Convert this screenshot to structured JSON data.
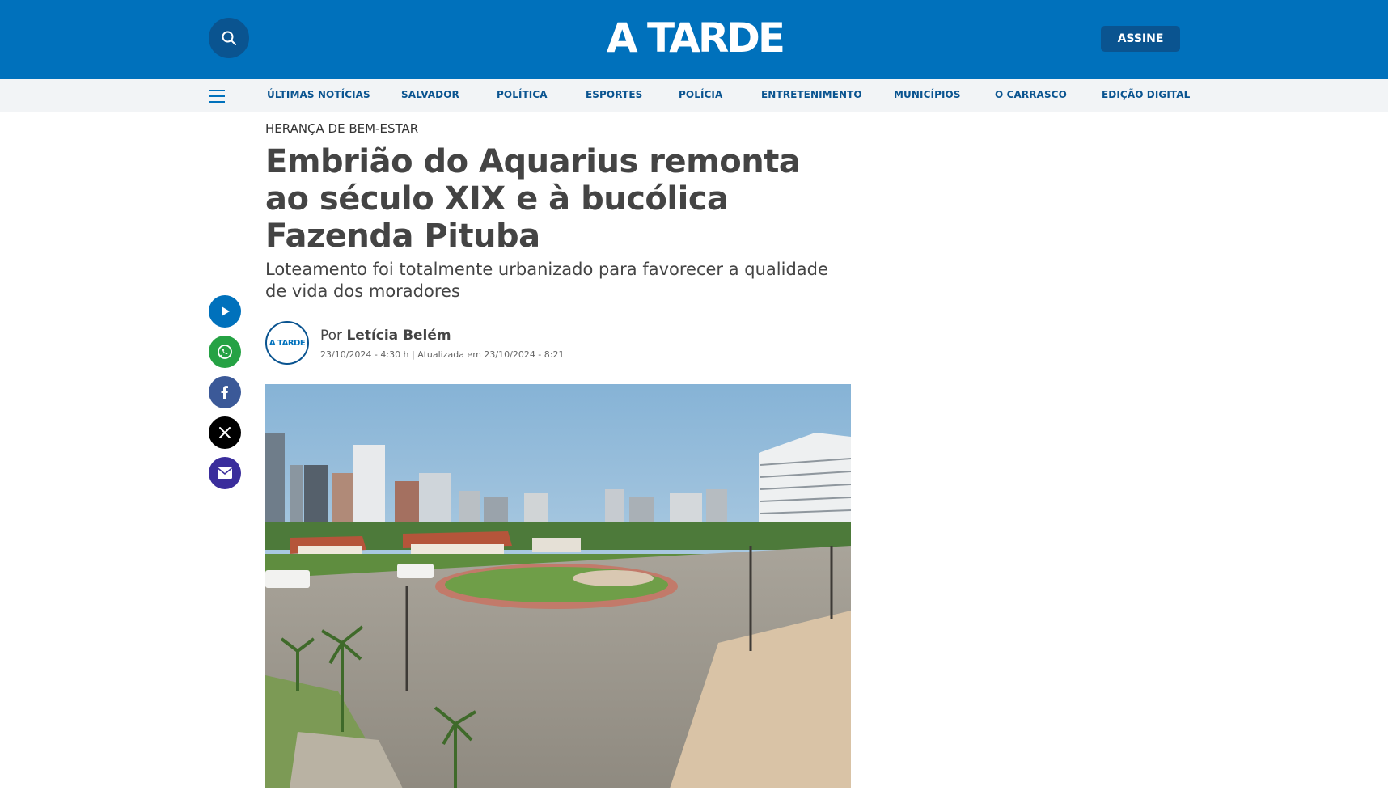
{
  "header": {
    "logo": "A TARDE",
    "subscribe_label": "ASSINE",
    "search_icon": "search-icon"
  },
  "nav": {
    "menu_icon": "hamburger-menu-icon",
    "items": [
      "ÚLTIMAS NOTÍCIAS",
      "SALVADOR",
      "POLÍTICA",
      "ESPORTES",
      "POLÍCIA",
      "ENTRETENIMENTO",
      "MUNICÍPIOS",
      "O CARRASCO",
      "EDIÇÃO DIGITAL"
    ]
  },
  "article": {
    "kicker": "HERANÇA DE BEM-ESTAR",
    "headline": "Embrião do Aquarius remonta ao século XIX e à bucólica Fazenda Pituba",
    "subtitle": "Loteamento foi totalmente urbanizado para favorecer a qualidade de vida dos moradores",
    "author_prefix": "Por",
    "author": "Letícia Belém",
    "dates": "23/10/2024 - 4:30 h | Atualizada em 23/10/2024 - 8:21",
    "avatar_logo": "A TARDE"
  },
  "share": [
    {
      "name": "play-icon",
      "color": "#0071bc"
    },
    {
      "name": "whatsapp-icon",
      "color": "#25a244"
    },
    {
      "name": "facebook-icon",
      "color": "#3b5998"
    },
    {
      "name": "x-icon",
      "color": "#000000"
    },
    {
      "name": "email-icon",
      "color": "#3a2d9c"
    }
  ],
  "colors": {
    "brand": "#0071bc",
    "brand_dark": "#0a5490",
    "nav_bg": "#f2f4f6"
  }
}
